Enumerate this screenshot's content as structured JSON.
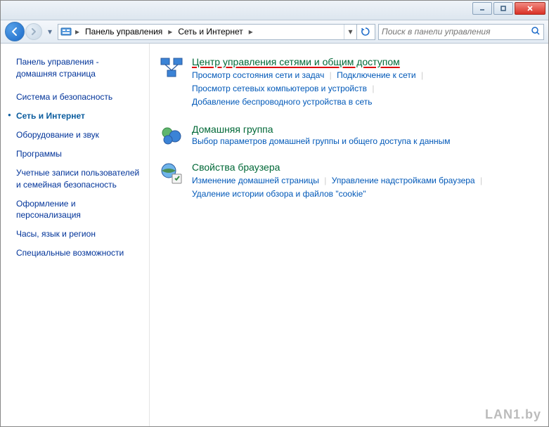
{
  "breadcrumb": {
    "item1": "Панель управления",
    "item2": "Сеть и Интернет"
  },
  "search": {
    "placeholder": "Поиск в панели управления"
  },
  "sidebar": {
    "home_line1": "Панель управления -",
    "home_line2": "домашняя страница",
    "items": [
      "Система и безопасность",
      "Сеть и Интернет",
      "Оборудование и звук",
      "Программы",
      "Учетные записи пользователей и семейная безопасность",
      "Оформление и персонализация",
      "Часы, язык и регион",
      "Специальные возможности"
    ]
  },
  "sections": {
    "network": {
      "title": "Центр управления сетями и общим доступом",
      "links": [
        "Просмотр состояния сети и задач",
        "Подключение к сети",
        "Просмотр сетевых компьютеров и устройств",
        "Добавление беспроводного устройства в сеть"
      ]
    },
    "homegroup": {
      "title": "Домашняя группа",
      "subtitle": "Выбор параметров домашней группы и общего доступа к данным"
    },
    "browser": {
      "title": "Свойства браузера",
      "links": [
        "Изменение домашней страницы",
        "Управление надстройками браузера",
        "Удаление истории обзора и файлов \"cookie\""
      ]
    }
  },
  "watermark": "LAN1.by"
}
